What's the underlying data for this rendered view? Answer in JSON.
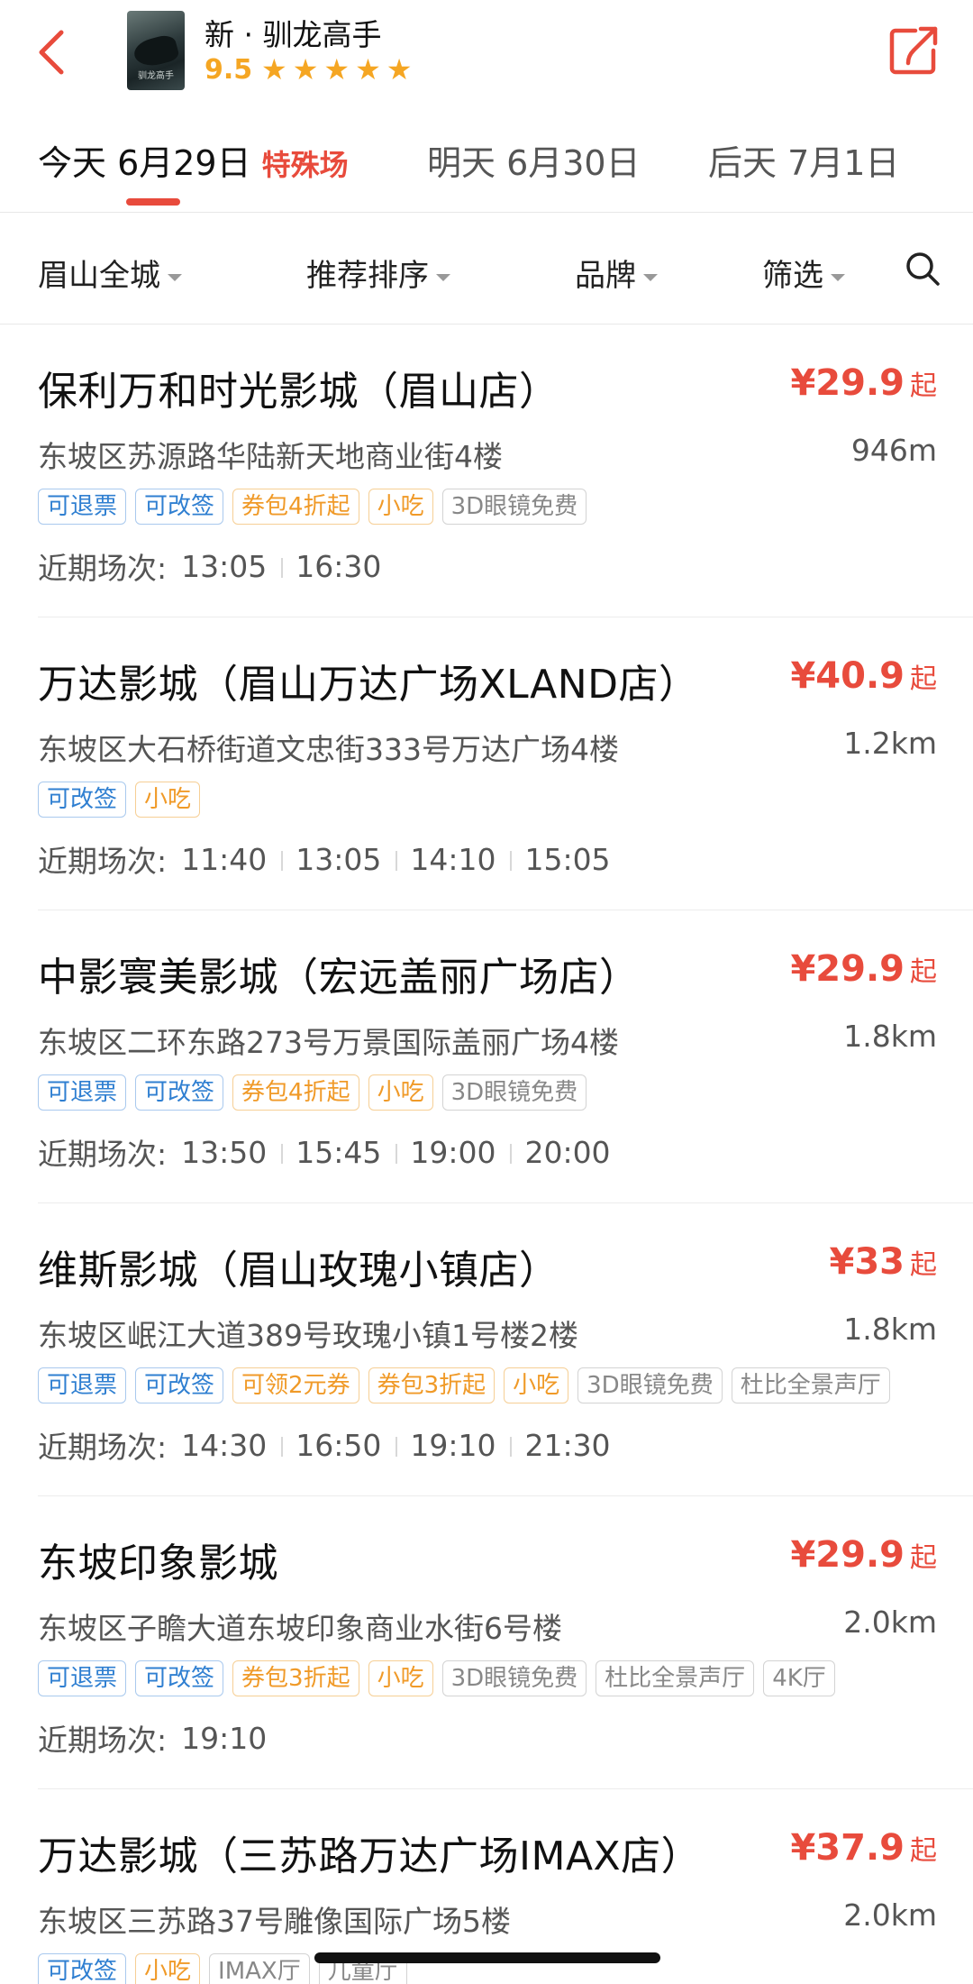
{
  "header": {
    "movie_title": "新 · 驯龙高手",
    "rating": "9.5",
    "stars": 5,
    "poster_text": "驯龙高手"
  },
  "dates": [
    {
      "label": "今天 6月29日",
      "badge": "特殊场",
      "active": true
    },
    {
      "label": "明天 6月30日"
    },
    {
      "label": "后天 7月1日"
    }
  ],
  "filters": [
    {
      "label": "眉山全城"
    },
    {
      "label": "推荐排序"
    },
    {
      "label": "品牌"
    },
    {
      "label": "筛选"
    }
  ],
  "cinemas": [
    {
      "name": "保利万和时光影城（眉山店）",
      "price": "¥29.9",
      "price_suffix": "起",
      "address": "东坡区苏源路华陆新天地商业街4楼",
      "distance": "946m",
      "tags": [
        {
          "text": "可退票",
          "style": "blue"
        },
        {
          "text": "可改签",
          "style": "blue"
        },
        {
          "text": "券包4折起",
          "style": "orange"
        },
        {
          "text": "小吃",
          "style": "orange"
        },
        {
          "text": "3D眼镜免费",
          "style": "gray"
        }
      ],
      "shows_label": "近期场次:",
      "shows": [
        "13:05",
        "16:30"
      ]
    },
    {
      "name": "万达影城（眉山万达广场XLAND店）",
      "price": "¥40.9",
      "price_suffix": "起",
      "address": "东坡区大石桥街道文忠街333号万达广场4楼",
      "distance": "1.2km",
      "tags": [
        {
          "text": "可改签",
          "style": "blue"
        },
        {
          "text": "小吃",
          "style": "orange"
        }
      ],
      "shows_label": "近期场次:",
      "shows": [
        "11:40",
        "13:05",
        "14:10",
        "15:05"
      ]
    },
    {
      "name": "中影寰美影城（宏远盖丽广场店）",
      "price": "¥29.9",
      "price_suffix": "起",
      "address": "东坡区二环东路273号万景国际盖丽广场4楼",
      "distance": "1.8km",
      "tags": [
        {
          "text": "可退票",
          "style": "blue"
        },
        {
          "text": "可改签",
          "style": "blue"
        },
        {
          "text": "券包4折起",
          "style": "orange"
        },
        {
          "text": "小吃",
          "style": "orange"
        },
        {
          "text": "3D眼镜免费",
          "style": "gray"
        }
      ],
      "shows_label": "近期场次:",
      "shows": [
        "13:50",
        "15:45",
        "19:00",
        "20:00"
      ]
    },
    {
      "name": "维斯影城（眉山玫瑰小镇店）",
      "price": "¥33",
      "price_suffix": "起",
      "address": "东坡区岷江大道389号玫瑰小镇1号楼2楼",
      "distance": "1.8km",
      "tags": [
        {
          "text": "可退票",
          "style": "blue"
        },
        {
          "text": "可改签",
          "style": "blue"
        },
        {
          "text": "可领2元券",
          "style": "orange"
        },
        {
          "text": "券包3折起",
          "style": "orange"
        },
        {
          "text": "小吃",
          "style": "orange"
        },
        {
          "text": "3D眼镜免费",
          "style": "gray"
        },
        {
          "text": "杜比全景声厅",
          "style": "gray"
        }
      ],
      "shows_label": "近期场次:",
      "shows": [
        "14:30",
        "16:50",
        "19:10",
        "21:30"
      ]
    },
    {
      "name": "东坡印象影城",
      "price": "¥29.9",
      "price_suffix": "起",
      "address": "东坡区子瞻大道东坡印象商业水街6号楼",
      "distance": "2.0km",
      "tags": [
        {
          "text": "可退票",
          "style": "blue"
        },
        {
          "text": "可改签",
          "style": "blue"
        },
        {
          "text": "券包3折起",
          "style": "orange"
        },
        {
          "text": "小吃",
          "style": "orange"
        },
        {
          "text": "3D眼镜免费",
          "style": "gray"
        },
        {
          "text": "杜比全景声厅",
          "style": "gray"
        },
        {
          "text": "4K厅",
          "style": "gray"
        }
      ],
      "shows_label": "近期场次:",
      "shows": [
        "19:10"
      ]
    },
    {
      "name": "万达影城（三苏路万达广场IMAX店）",
      "price": "¥37.9",
      "price_suffix": "起",
      "address": "东坡区三苏路37号雕像国际广场5楼",
      "distance": "2.0km",
      "tags": [
        {
          "text": "可改签",
          "style": "blue"
        },
        {
          "text": "小吃",
          "style": "orange"
        },
        {
          "text": "IMAX厅",
          "style": "gray"
        },
        {
          "text": "儿童厅",
          "style": "gray"
        }
      ],
      "shows_label": "",
      "shows": []
    }
  ],
  "colors": {
    "accent": "#e84b3c",
    "star": "#f5a623",
    "tag_blue": "#2f7fd1",
    "tag_orange": "#f09a28",
    "tag_gray": "#888888"
  },
  "icons": {
    "back": "chevron-left-icon",
    "share": "share-icon",
    "search": "search-icon",
    "caret": "caret-down-icon"
  }
}
